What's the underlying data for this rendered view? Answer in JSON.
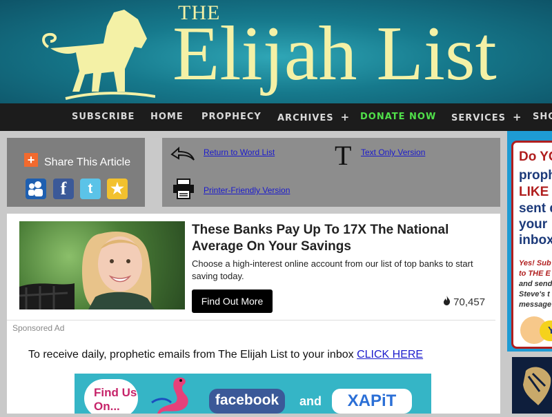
{
  "header": {
    "brand_small": "THE",
    "brand_large": "Elijah List"
  },
  "nav": {
    "items": [
      "SUBSCRIBE",
      "HOME",
      "PROPHECY",
      "ARCHIVES",
      "DONATE NOW",
      "SERVICES",
      "SHO"
    ],
    "expandable_symbol": "+"
  },
  "share": {
    "title": "Share This Article",
    "icons": [
      "myspace-icon",
      "facebook-icon",
      "twitter-icon",
      "favorite-star-icon"
    ]
  },
  "tools": {
    "return_link": "Return to Word List",
    "text_only_link": "Text Only Version",
    "printer_link": "Printer-Friendly Version"
  },
  "ad": {
    "title": "These Banks Pay Up To 17X The National Average On Your Savings",
    "description": "Choose a high-interest online account from our list of top banks to start saving today.",
    "button": "Find Out More",
    "count": "70,457",
    "sponsored_label": "Sponsored Ad"
  },
  "cta": {
    "text": "To receive daily, prophetic emails from The Elijah List to your inbox",
    "link": "CLICK HERE"
  },
  "promo": {
    "find_us": "Find Us On...",
    "facebook": "facebook",
    "and": "and",
    "xapit": "XAPiT"
  },
  "sidebar_ad": {
    "lines": [
      "Do YO",
      "proph",
      "LIKE T",
      "sent d",
      "your",
      "inbox"
    ],
    "small_lines": [
      "Yes! Sub",
      "to THE E",
      "and send",
      "Steve's t",
      "message"
    ],
    "button_text": "Y"
  },
  "colors": {
    "banner": "#16798c",
    "brand_text": "#f4f1a6",
    "nav_bg": "#1c1c1c",
    "donate": "#50e04a",
    "link": "#1a1acc"
  }
}
